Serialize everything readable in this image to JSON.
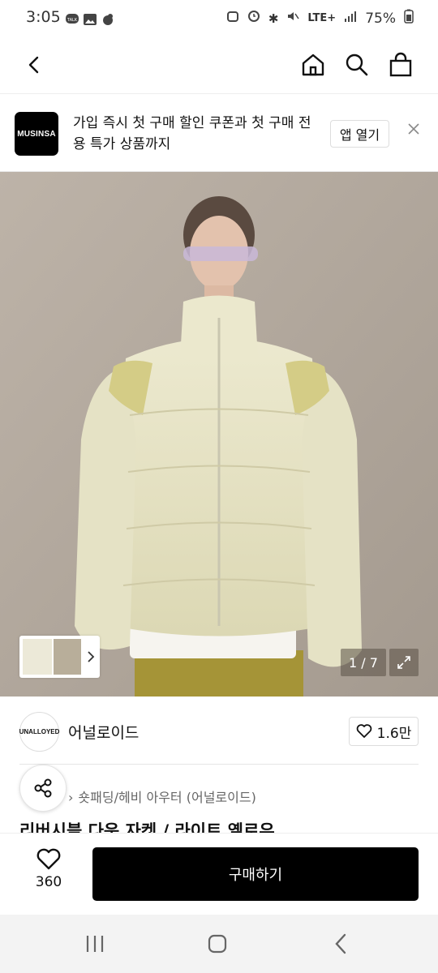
{
  "status_bar": {
    "time": "3:05",
    "left_icons": [
      "talk-icon",
      "gallery-icon",
      "notification-icon"
    ],
    "network": "LTE+",
    "battery": "75%"
  },
  "header": {
    "icons": [
      "back-icon",
      "home-icon",
      "search-icon",
      "bag-icon"
    ]
  },
  "promo": {
    "logo_text": "MUSINSA",
    "text": "가입 즉시 첫 구매 할인 쿠폰과 첫 구매 전용 특가 상품까지",
    "open_label": "앱 열기"
  },
  "gallery": {
    "counter": "1 / 7"
  },
  "brand": {
    "logo_text": "UNALLOYED",
    "name": "어널로이드",
    "likes": "1.6만"
  },
  "product": {
    "breadcrumb": "숏패딩/헤비 아우터 (어널로이드)",
    "title": "리버시블 다운 자켓 / 라이트 옐로우"
  },
  "action_bar": {
    "wish_count": "360",
    "buy_label": "구매하기"
  },
  "colors": {
    "accent": "#000000",
    "jacket": "#e6e2c0",
    "background": "#aba197"
  }
}
